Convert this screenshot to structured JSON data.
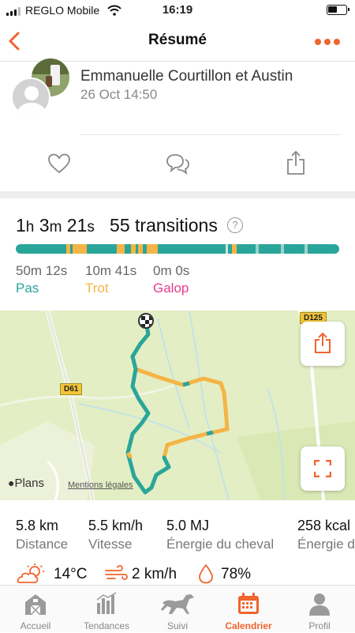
{
  "status_bar": {
    "carrier": "REGLO Mobile",
    "time": "16:19"
  },
  "nav": {
    "title": "Résumé"
  },
  "post": {
    "author": "Emmanuelle Courtillon et Austin",
    "date": "26 Oct 14:50"
  },
  "summary": {
    "duration": {
      "h": "1",
      "h_unit": "h",
      "m": "3",
      "m_unit": "m",
      "s": "21",
      "s_unit": "s"
    },
    "transitions": "55 transitions",
    "help_symbol": "?",
    "gaits": [
      {
        "time": "50m 12s",
        "name": "Pas",
        "color": "#2aa59a"
      },
      {
        "time": "10m 41s",
        "name": "Trot",
        "color": "#f5b445"
      },
      {
        "time": "0m 0s",
        "name": "Galop",
        "color": "#e83c8e"
      }
    ]
  },
  "map": {
    "road_labels": [
      "D61",
      "D125"
    ],
    "provider": "Plans",
    "legal": "Mentions légales"
  },
  "stats": [
    {
      "value": "5.8 km",
      "label": "Distance"
    },
    {
      "value": "5.5 km/h",
      "label": "Vitesse"
    },
    {
      "value": "5.0 MJ",
      "label": "Énergie du cheval"
    },
    {
      "value": "258 kcal",
      "label": "Énergie du cavalier"
    }
  ],
  "weather": {
    "temperature": "14°C",
    "wind": "2 km/h",
    "humidity": "78%"
  },
  "tabs": [
    {
      "label": "Accueil",
      "icon": "barn-icon",
      "active": false
    },
    {
      "label": "Tendances",
      "icon": "bar-chart-icon",
      "active": false
    },
    {
      "label": "Suivi",
      "icon": "horse-icon",
      "active": false
    },
    {
      "label": "Calendrier",
      "icon": "calendar-icon",
      "active": true
    },
    {
      "label": "Profil",
      "icon": "profile-icon",
      "active": false
    }
  ],
  "colors": {
    "accent": "#f0642d",
    "walk": "#2aa59a",
    "trot": "#f5b445",
    "gallop": "#e83c8e"
  }
}
